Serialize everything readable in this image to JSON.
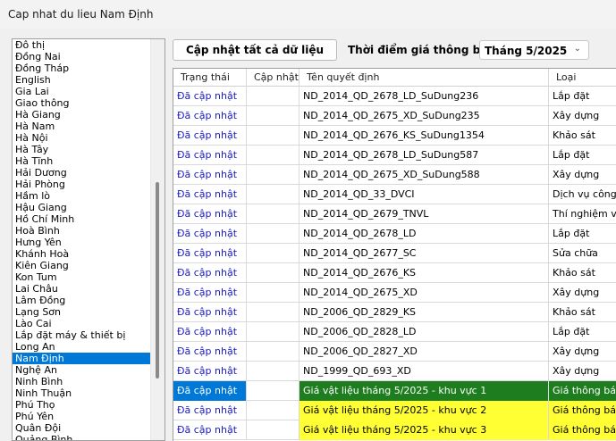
{
  "window": {
    "title": "Cap nhat du lieu Nam Định"
  },
  "provinces": {
    "items": [
      "Đô thị",
      "Đồng Nai",
      "Đồng Tháp",
      "English",
      "Gia Lai",
      "Giao thông",
      "Hà Giang",
      "Hà Nam",
      "Hà Nội",
      "Hà Tây",
      "Hà Tĩnh",
      "Hải Dương",
      "Hải Phòng",
      "Hầm lò",
      "Hậu Giang",
      "Hồ Chí Minh",
      "Hoà Bình",
      "Hưng Yên",
      "Khánh Hoà",
      "Kiên Giang",
      "Kon Tum",
      "Lai Châu",
      "Lâm Đồng",
      "Lạng Sơn",
      "Lào Cai",
      "Lắp đặt máy & thiết bị",
      "Long An",
      "Nam Định",
      "Nghệ An",
      "Ninh Bình",
      "Ninh Thuận",
      "Phú Thọ",
      "Phú Yên",
      "Quân Đội",
      "Quảng Bình"
    ],
    "selected": "Nam Định"
  },
  "toolbar": {
    "update_all_label": "Cập nhật tất cả dữ liệu",
    "time_label": "Thời điểm giá thông báo",
    "month_value": "Tháng 5/2025"
  },
  "grid": {
    "columns": [
      "Trạng thái",
      "Cập nhật",
      "Tên quyết định",
      "Loại"
    ],
    "rows": [
      {
        "status": "Đã cập nhật",
        "update": "",
        "name": "ND_2014_QD_2678_LD_SuDung236",
        "type": "Lắp đặt",
        "highlight": "none"
      },
      {
        "status": "Đã cập nhật",
        "update": "",
        "name": "ND_2014_QD_2675_XD_SuDung235",
        "type": "Xây dựng",
        "highlight": "none"
      },
      {
        "status": "Đã cập nhật",
        "update": "",
        "name": "ND_2014_QD_2676_KS_SuDung1354",
        "type": "Khảo sát",
        "highlight": "none"
      },
      {
        "status": "Đã cập nhật",
        "update": "",
        "name": "ND_2014_QD_2678_LD_SuDung587",
        "type": "Lắp đặt",
        "highlight": "none"
      },
      {
        "status": "Đã cập nhật",
        "update": "",
        "name": "ND_2014_QD_2675_XD_SuDung588",
        "type": "Xây dựng",
        "highlight": "none"
      },
      {
        "status": "Đã cập nhật",
        "update": "",
        "name": "ND_2014_QD_33_DVCI",
        "type": "Dịch vụ công í",
        "highlight": "none"
      },
      {
        "status": "Đã cập nhật",
        "update": "",
        "name": "ND_2014_QD_2679_TNVL",
        "type": "Thí nghiệm vật",
        "highlight": "none"
      },
      {
        "status": "Đã cập nhật",
        "update": "",
        "name": "ND_2014_QD_2678_LD",
        "type": "Lắp đặt",
        "highlight": "none"
      },
      {
        "status": "Đã cập nhật",
        "update": "",
        "name": "ND_2014_QD_2677_SC",
        "type": "Sửa chữa",
        "highlight": "none"
      },
      {
        "status": "Đã cập nhật",
        "update": "",
        "name": "ND_2014_QD_2676_KS",
        "type": "Khảo sát",
        "highlight": "none"
      },
      {
        "status": "Đã cập nhật",
        "update": "",
        "name": "ND_2014_QD_2675_XD",
        "type": "Xây dựng",
        "highlight": "none"
      },
      {
        "status": "Đã cập nhật",
        "update": "",
        "name": "ND_2006_QD_2829_KS",
        "type": "Khảo sát",
        "highlight": "none"
      },
      {
        "status": "Đã cập nhật",
        "update": "",
        "name": "ND_2006_QD_2828_LD",
        "type": "Lắp đặt",
        "highlight": "none"
      },
      {
        "status": "Đã cập nhật",
        "update": "",
        "name": "ND_2006_QD_2827_XD",
        "type": "Xây dựng",
        "highlight": "none"
      },
      {
        "status": "Đã cập nhật",
        "update": "",
        "name": "ND_1999_QD_693_XD",
        "type": "Xây dựng",
        "highlight": "none"
      },
      {
        "status": "Đã cập nhật",
        "update": "",
        "name": "Giá vật liệu tháng 5/2025 - khu vực 1",
        "type": "Giá thông báo",
        "highlight": "green",
        "selected": true
      },
      {
        "status": "Đã cập nhật",
        "update": "",
        "name": "Giá vật liệu tháng 5/2025 - khu vực 2",
        "type": "Giá thông báo",
        "highlight": "yellow"
      },
      {
        "status": "Đã cập nhật",
        "update": "",
        "name": "Giá vật liệu tháng 5/2025 - khu vực 3",
        "type": "Giá thông báo",
        "highlight": "yellow"
      }
    ]
  }
}
